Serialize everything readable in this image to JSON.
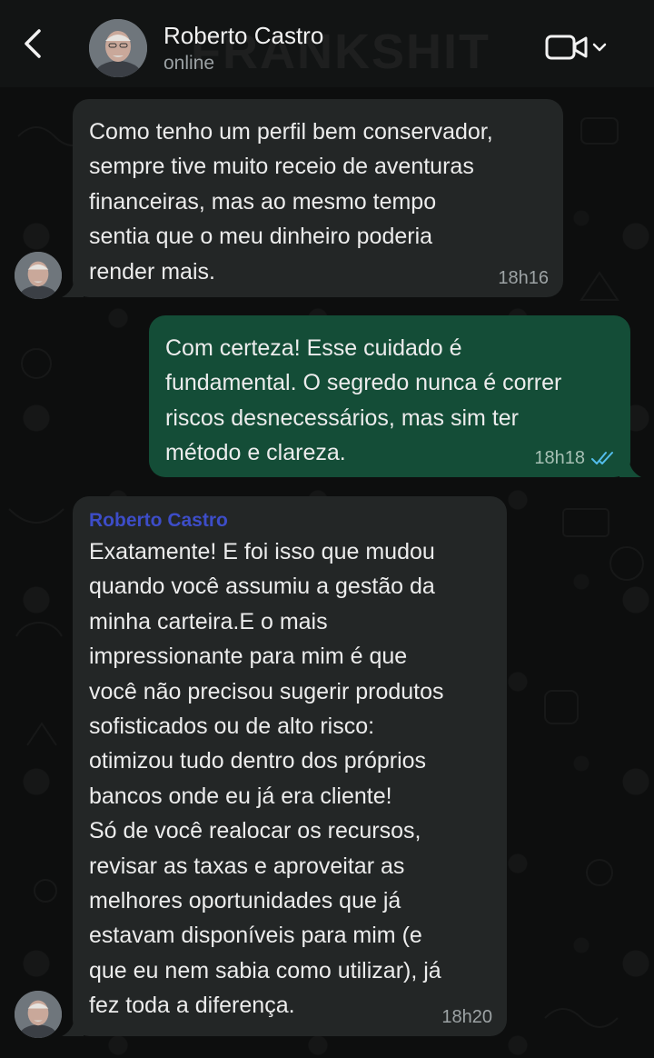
{
  "header": {
    "contact_name": "Roberto Castro",
    "status": "online",
    "icons": [
      "back-arrow-icon",
      "video-camera-icon",
      "chevron-down-icon"
    ]
  },
  "watermark": "FRANKSHIT",
  "colors": {
    "header_bg": "#121414",
    "incoming_bubble": "#232626",
    "outgoing_bubble": "#144d37",
    "sender_name": "#3d4dc8",
    "read_ticks": "#53bdeb"
  },
  "messages": [
    {
      "direction": "incoming",
      "text": "Como tenho um perfil bem conservador,\nsempre tive muito receio de aventuras\nfinanceiras, mas ao mesmo tempo\nsentia que o meu dinheiro poderia\nrender mais.",
      "time": "18h16"
    },
    {
      "direction": "outgoing",
      "text": "Com certeza! Esse cuidado é\nfundamental. O segredo nunca é correr\nriscos desnecessários, mas sim ter\nmétodo e clareza.",
      "time": "18h18",
      "status": "read"
    },
    {
      "direction": "incoming",
      "sender": "Roberto Castro",
      "text": "Exatamente! E foi isso que mudou\nquando você assumiu a gestão da\nminha carteira.E o mais\nimpressionante para mim é que\nvocê não precisou sugerir produtos\nsofisticados ou de alto risco:\notimizou tudo dentro dos próprios\nbancos onde eu já era cliente!\nSó de você realocar os recursos,\nrevisar as taxas e aproveitar as\nmelhores oportunidades que já\nestavam disponíveis para mim (e\nque eu nem sabia como utilizar), já\nfez toda a diferença.",
      "time": "18h20"
    }
  ]
}
